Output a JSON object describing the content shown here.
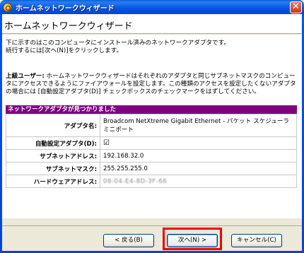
{
  "window": {
    "title": "ホームネットワークウィザード",
    "close_glyph": "✕"
  },
  "header": {
    "title": "ホームネットワークウィザード"
  },
  "intro": {
    "line1": "下に示すのはこのコンピュータにインストール済みのネットワークアダプタです。",
    "line2": "続行するには[次へ(N)]をクリックします。"
  },
  "advanced": {
    "label": "上級ユーザー:",
    "text": " ホームネットワークウィザードはそれぞれのアダプタと同じサブネットマスクのコンピュータにアクセスできるようにファイアウォールを設定します。この種類のアクセスを設定したくないアダプタの場合には [自動設定アダプタ(D)] チェックボックスのチェックマークをはずしてください。"
  },
  "section": {
    "title": "ネットワークアダプタが見つかりました"
  },
  "adapter_table": {
    "rows": [
      {
        "label": "アダプタ名:",
        "value": "Broadcom NetXtreme Gigabit Ethernet - パケット スケジューラ ミニポート"
      },
      {
        "label": "自動設定アダプタ(D):",
        "value": "☑"
      },
      {
        "label": "サブネットアドレス:",
        "value": "192.168.32.0"
      },
      {
        "label": "サブネットマスク:",
        "value": "255.255.255.0"
      },
      {
        "label": "ハードウェアアドレス:",
        "value": "08-04-E4-8D-3F-66"
      }
    ]
  },
  "buttons": {
    "back": "< 戻る(B)",
    "next": "次へ(N) >",
    "cancel": "キャンセル(C)"
  },
  "colors": {
    "section_bar": "#800080",
    "highlight": "#ee0000",
    "titlebar": "#0055e5"
  }
}
